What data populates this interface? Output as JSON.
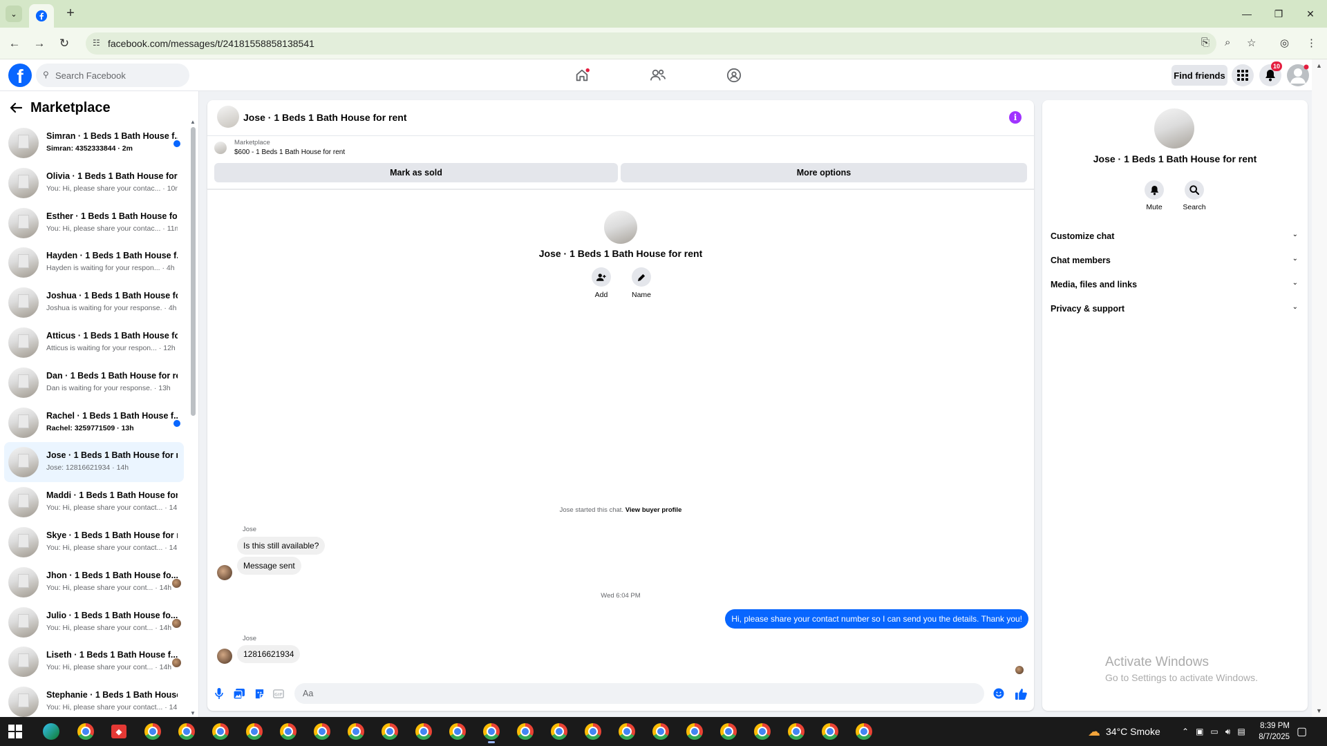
{
  "browser": {
    "url": "facebook.com/messages/t/24181558858138541",
    "new_tab_glyph": "+",
    "minimize_glyph": "—",
    "restore_glyph": "❐",
    "close_glyph": "✕"
  },
  "header": {
    "logo_letter": "f",
    "search_placeholder": "Search Facebook",
    "find_friends_label": "Find friends",
    "notification_count": "10"
  },
  "sidebar": {
    "title": "Marketplace",
    "conversations": [
      {
        "name": "Simran · 1 Beds 1 Bath House f...",
        "preview": "Simran: 4352333844 · 2m",
        "unread": true
      },
      {
        "name": "Olivia · 1 Beds 1 Bath House for ...",
        "preview": "You: Hi, please share your contac... · 10m"
      },
      {
        "name": "Esther · 1 Beds 1 Bath House for ...",
        "preview": "You: Hi, please share your contac... · 11m"
      },
      {
        "name": "Hayden · 1 Beds 1 Bath House f...",
        "preview": "Hayden is waiting for your respon... · 4h"
      },
      {
        "name": "Joshua · 1 Beds 1 Bath House fo...",
        "preview": "Joshua is waiting for your response. · 4h"
      },
      {
        "name": "Atticus · 1 Beds 1 Bath House fo...",
        "preview": "Atticus is waiting for your respon... · 12h"
      },
      {
        "name": "Dan · 1 Beds 1 Bath House for re...",
        "preview": "Dan is waiting for your response. · 13h"
      },
      {
        "name": "Rachel · 1 Beds 1 Bath House f...",
        "preview": "Rachel: 3259771509 · 13h",
        "unread": true
      },
      {
        "name": "Jose · 1 Beds 1 Bath House for r...",
        "preview": "Jose: 12816621934 · 14h"
      },
      {
        "name": "Maddi · 1 Beds 1 Bath House for...",
        "preview": "You: Hi, please share your contact... · 14h"
      },
      {
        "name": "Skye · 1 Beds 1 Bath House for r...",
        "preview": "You: Hi, please share your contact... · 14h"
      },
      {
        "name": "Jhon · 1 Beds 1 Bath House fo...",
        "preview": "You: Hi, please share your cont... · 14h",
        "seen": true
      },
      {
        "name": "Julio · 1 Beds 1 Bath House fo...",
        "preview": "You: Hi, please share your cont... · 14h",
        "seen": true
      },
      {
        "name": "Liseth · 1 Beds 1 Bath House f...",
        "preview": "You: Hi, please share your cont... · 14h",
        "seen": true
      },
      {
        "name": "Stephanie · 1 Beds 1 Bath House...",
        "preview": "You: Hi, please share your contact... · 14h"
      }
    ]
  },
  "chat": {
    "title": "Jose · 1 Beds 1 Bath House for rent",
    "listing_category": "Marketplace",
    "listing_price": "$600 - 1 Beds 1 Bath House for rent",
    "mark_sold_label": "Mark as sold",
    "more_options_label": "More options",
    "profile_name": "Jose · 1 Beds 1 Bath House for rent",
    "add_label": "Add",
    "name_label": "Name",
    "started_text": "Jose started this chat.",
    "view_profile_label": "View buyer profile",
    "sender_name": "Jose",
    "msg1": "Is this still available?",
    "msg2": "Message sent",
    "timestamp": "Wed 6:04 PM",
    "outgoing": "Hi, please share your contact number so I can send you the details. Thank you!",
    "msg3": "12816621934",
    "composer_placeholder": "Aa"
  },
  "panel": {
    "name": "Jose · 1 Beds 1 Bath House for rent",
    "mute_label": "Mute",
    "search_label": "Search",
    "sections": [
      "Customize chat",
      "Chat members",
      "Media, files and links",
      "Privacy & support"
    ]
  },
  "watermark": {
    "line1": "Activate Windows",
    "line2": "Go to Settings to activate Windows."
  },
  "taskbar": {
    "weather": "34°C  Smoke",
    "time": "8:39 PM",
    "date": "8/7/2025"
  },
  "colors": {
    "fb_blue": "#0866ff",
    "active_row": "#ebf5ff",
    "badge_red": "#e41e3f",
    "info_purple": "#a033ff"
  }
}
